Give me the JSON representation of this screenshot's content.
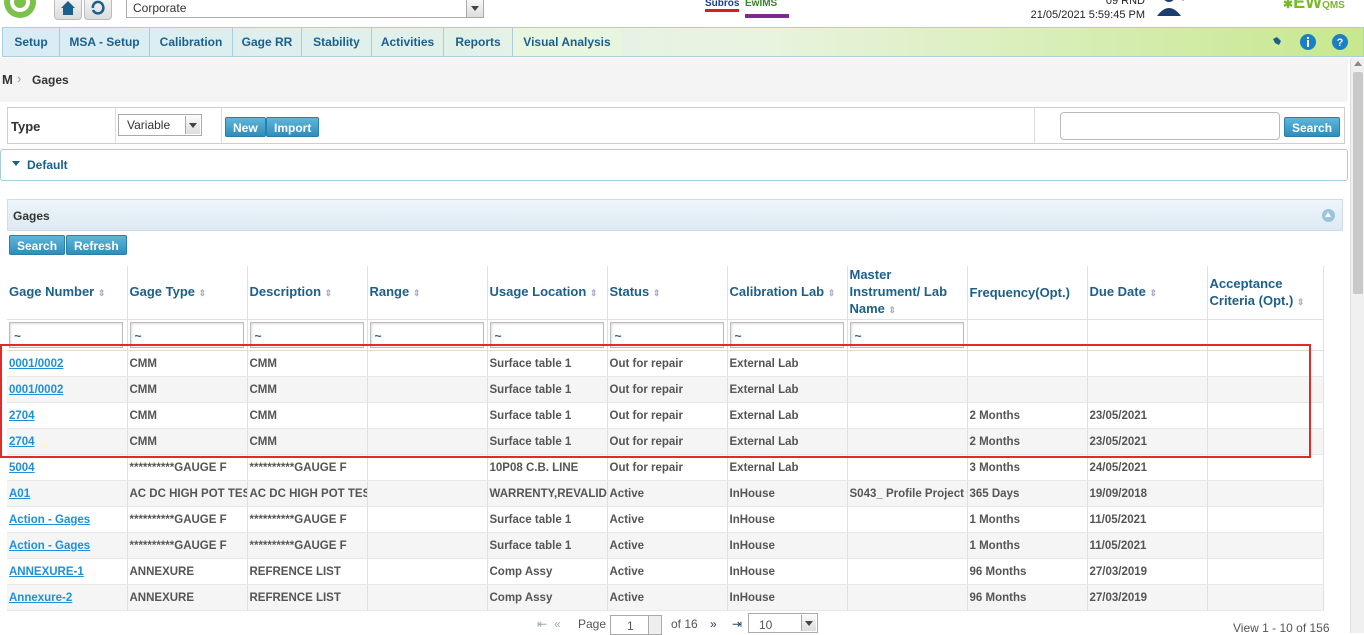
{
  "header": {
    "company_select": "Corporate",
    "user_code": "09 RND",
    "datetime": "21/05/2021 5:59:45 PM",
    "brand_logo_text": "Subros",
    "brand_logo_text2": "EwIMS",
    "product_logo": "EW",
    "product_logo_sub": "QMS"
  },
  "nav": {
    "items": [
      "Setup",
      "MSA - Setup",
      "Calibration",
      "Gage RR",
      "Stability",
      "Activities",
      "Reports",
      "Visual Analysis"
    ]
  },
  "breadcrumb": {
    "root_logo": "M",
    "title": "Gages"
  },
  "toolbar": {
    "type_label": "Type",
    "type_value": "Variable",
    "new_label": "New",
    "import_label": "Import",
    "search_label": "Search",
    "search_value": ""
  },
  "default_section": {
    "label": "Default"
  },
  "gages_panel": {
    "title": "Gages",
    "search_label": "Search",
    "refresh_label": "Refresh"
  },
  "table": {
    "columns": [
      "Gage Number",
      "Gage Type",
      "Description",
      "Range",
      "Usage Location",
      "Status",
      "Calibration Lab",
      "Master Instrument/ Lab Name",
      "Frequency(Opt.)",
      "Due Date",
      "Acceptance Criteria (Opt.)"
    ],
    "filter_value": "~",
    "rows": [
      [
        "0001/0002",
        "CMM",
        "CMM",
        "",
        "Surface table 1",
        "Out for repair",
        "External Lab",
        "",
        "",
        "",
        ""
      ],
      [
        "0001/0002",
        "CMM",
        "CMM",
        "",
        "Surface table 1",
        "Out for repair",
        "External Lab",
        "",
        "",
        "",
        ""
      ],
      [
        "2704",
        "CMM",
        "CMM",
        "",
        "Surface table 1",
        "Out for repair",
        "External Lab",
        "",
        "2 Months",
        "23/05/2021",
        ""
      ],
      [
        "2704",
        "CMM",
        "CMM",
        "",
        "Surface table 1",
        "Out for repair",
        "External Lab",
        "",
        "2 Months",
        "23/05/2021",
        ""
      ],
      [
        "5004",
        "**********GAUGE F",
        "**********GAUGE F",
        "",
        "10P08 C.B. LINE",
        "Out for repair",
        "External Lab",
        "",
        "3 Months",
        "24/05/2021",
        ""
      ],
      [
        "A01",
        "AC DC HIGH POT TEST",
        "AC DC HIGH POT TEST",
        "",
        "WARRENTY,REVALIDA",
        "Active",
        "InHouse",
        "S043_ Profile Project",
        "365 Days",
        "19/09/2018",
        ""
      ],
      [
        "Action - Gages",
        "**********GAUGE F",
        "**********GAUGE F",
        "",
        "Surface table 1",
        "Active",
        "InHouse",
        "",
        "1 Months",
        "11/05/2021",
        ""
      ],
      [
        "Action - Gages",
        "**********GAUGE F",
        "**********GAUGE F",
        "",
        "Surface table 1",
        "Active",
        "InHouse",
        "",
        "1 Months",
        "11/05/2021",
        ""
      ],
      [
        "ANNEXURE-1",
        "ANNEXURE",
        "REFRENCE LIST",
        "",
        "Comp Assy",
        "Active",
        "InHouse",
        "",
        "96 Months",
        "27/03/2019",
        ""
      ],
      [
        "Annexure-2",
        "ANNEXURE",
        "REFRENCE LIST",
        "",
        "Comp Assy",
        "Active",
        "InHouse",
        "",
        "96 Months",
        "27/03/2019",
        ""
      ]
    ]
  },
  "pager": {
    "page_label": "Page",
    "page_value": "1",
    "of_label": "of 16",
    "rows_value": "10",
    "view_text": "View 1 - 10 of 156"
  },
  "colors": {
    "accent": "#1b5f8c",
    "link": "#1f8fd8",
    "highlight_border": "#e02b2b",
    "brand_green": "#79b829"
  }
}
